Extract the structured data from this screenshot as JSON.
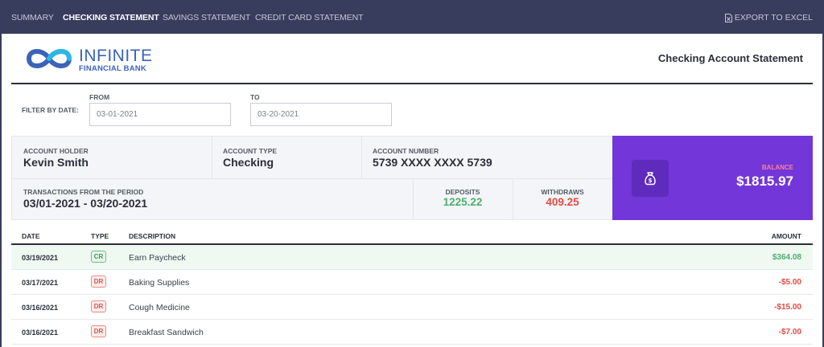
{
  "nav": {
    "tabs": [
      {
        "label": "SUMMARY",
        "active": false
      },
      {
        "label": "CHECKING STATEMENT",
        "active": true
      },
      {
        "label": "SAVINGS STATEMENT",
        "active": false
      },
      {
        "label": "CREDIT CARD STATEMENT",
        "active": false
      }
    ],
    "export_label": "EXPORT TO EXCEL"
  },
  "brand": {
    "line1": "INFINITE",
    "line2": "FINANCIAL BANK"
  },
  "statement_title": "Checking Account Statement",
  "filter": {
    "label": "FILTER BY DATE:",
    "from_label": "FROM",
    "from_value": "03-01-2021",
    "to_label": "TO",
    "to_value": "03-20-2021"
  },
  "account": {
    "holder_label": "ACCOUNT HOLDER",
    "holder": "Kevin Smith",
    "type_label": "ACCOUNT TYPE",
    "type": "Checking",
    "number_label": "ACCOUNT NUMBER",
    "number": "5739 XXXX XXXX 5739",
    "period_label": "TRANSACTIONS FROM THE PERIOD",
    "period": "03/01-2021 - 03/20-2021",
    "deposits_label": "DEPOSITS",
    "deposits": "1225.22",
    "withdraws_label": "WITHDRAWS",
    "withdraws": "409.25",
    "balance_label": "BALANCE",
    "balance": "$1815.97"
  },
  "table": {
    "headers": {
      "date": "DATE",
      "type": "TYPE",
      "description": "DESCRIPTION",
      "amount": "AMOUNT"
    },
    "rows": [
      {
        "date": "03/19/2021",
        "type": "CR",
        "description": "Earn Paycheck",
        "amount": "$364.08"
      },
      {
        "date": "03/17/2021",
        "type": "DR",
        "description": "Baking Supplies",
        "amount": "-$5.00"
      },
      {
        "date": "03/16/2021",
        "type": "DR",
        "description": "Cough Medicine",
        "amount": "-$15.00"
      },
      {
        "date": "03/16/2021",
        "type": "DR",
        "description": "Breakfast Sandwich",
        "amount": "-$7.00"
      }
    ]
  },
  "colors": {
    "nav_bg": "#383d5e",
    "brand_blue": "#3b63b8",
    "balance_bg": "#7236d9",
    "credit_green": "#4caf6e",
    "debit_red": "#e04b43"
  }
}
